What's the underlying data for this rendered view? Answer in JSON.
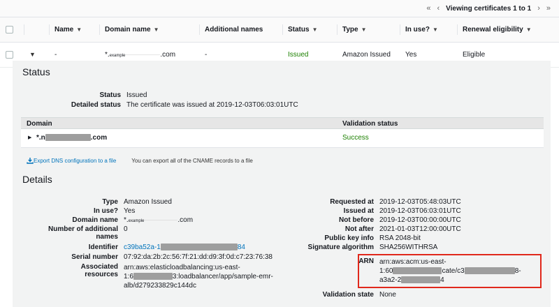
{
  "pager": {
    "first": "«",
    "prev": "‹",
    "viewing": "Viewing certificates 1 to 1",
    "next": "›",
    "last": "»"
  },
  "columns": [
    "Name",
    "Domain name",
    "Additional names",
    "Status",
    "Type",
    "In use?",
    "Renewal eligibility"
  ],
  "row": {
    "name": "-",
    "domain_prefix": "*.",
    "domain_small": "example",
    "domain_suffix": ".com",
    "additional_names": "-",
    "status": "Issued",
    "type": "Amazon Issued",
    "in_use": "Yes",
    "renewal": "Eligible"
  },
  "status_section": {
    "title": "Status",
    "status_label": "Status",
    "status_value": "Issued",
    "detailed_label": "Detailed status",
    "detailed_value": "The certificate was issued at 2019-12-03T06:03:01UTC"
  },
  "domain_table": {
    "col_domain": "Domain",
    "col_validation": "Validation status",
    "domain_prefix": "*.n",
    "domain_suffix": ".com",
    "validation": "Success"
  },
  "export": {
    "link": "Export DNS configuration to a file",
    "note": "You can export all of the CNAME records to a file"
  },
  "details": {
    "title": "Details",
    "type_label": "Type",
    "type_value": "Amazon Issued",
    "inuse_label": "In use?",
    "inuse_value": "Yes",
    "domain_label": "Domain name",
    "domain_prefix": "*.",
    "domain_small": "example",
    "domain_suffix": ".com",
    "addl_label": "Number of additional names",
    "addl_value": "0",
    "identifier_label": "Identifier",
    "identifier_prefix": "c39ba52a-1",
    "identifier_suffix": "84",
    "serial_label": "Serial number",
    "serial_value": "07:92:da:2b:2c:56:7f:21:dd:d9:3f:0d:c7:23:76:38",
    "assoc_label": "Associated resources",
    "assoc_line1": "arn:aws:elasticloadbalancing:us-east-",
    "assoc_line2_prefix": "1:6",
    "assoc_line2_suffix": "3:loadbalancer/app/sample-emr-",
    "assoc_line3": "alb/d279233829c144dc",
    "requested_label": "Requested at",
    "requested_value": "2019-12-03T05:48:03UTC",
    "issued_label": "Issued at",
    "issued_value": "2019-12-03T06:03:01UTC",
    "notbefore_label": "Not before",
    "notbefore_value": "2019-12-03T00:00:00UTC",
    "notafter_label": "Not after",
    "notafter_value": "2021-01-03T12:00:00UTC",
    "pubkey_label": "Public key info",
    "pubkey_value": "RSA 2048-bit",
    "sigalg_label": "Signature algorithm",
    "sigalg_value": "SHA256WITHRSA",
    "arn_label": "ARN",
    "arn_line1": "arn:aws:acm:us-east-",
    "arn_line2_a": "1:60",
    "arn_line2_b": "cate/c3",
    "arn_line2_c": "8-",
    "arn_line3_a": "a3a2-2",
    "arn_line3_b": "4",
    "validation_label": "Validation state",
    "validation_value": "None"
  },
  "colors": {
    "success": "#1d8102",
    "link": "#0073bb",
    "highlight": "#e0281b"
  }
}
